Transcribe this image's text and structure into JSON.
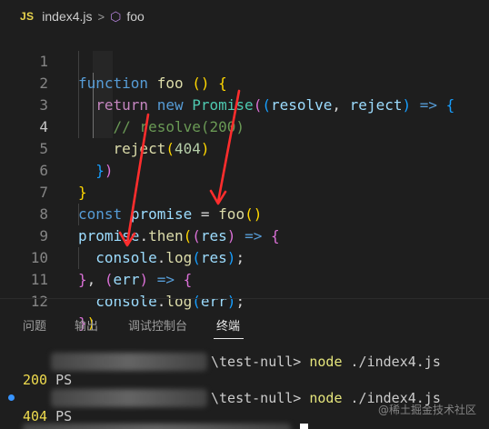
{
  "breadcrumb": {
    "file_badge": "JS",
    "file_name": "index4.js",
    "separator": ">",
    "symbol_icon": "cube-icon",
    "symbol_name": "foo"
  },
  "editor": {
    "active_line": 4,
    "line_numbers": [
      "1",
      "2",
      "3",
      "4",
      "5",
      "6",
      "7",
      "8",
      "9",
      "10",
      "11",
      "12"
    ],
    "lines": [
      "function foo () {",
      "  return new Promise((resolve, reject) => {",
      "    // resolve(200)",
      "    reject(404)",
      "  })",
      "}",
      "const promise = foo()",
      "promise.then((res) => {",
      "  console.log(res);",
      "}, (err) => {",
      "  console.log(err);",
      "})"
    ]
  },
  "annotation": {
    "arrow_color": "#ff2d2d"
  },
  "panel": {
    "tabs": [
      "问题",
      "输出",
      "调试控制台",
      "终端"
    ],
    "active_tab": "终端"
  },
  "terminal": {
    "runs": [
      {
        "prompt": "PS",
        "path": "\\test-null>",
        "command": "node",
        "args": "./index4.js",
        "output": "200"
      },
      {
        "prompt": "PS",
        "path": "\\test-null>",
        "command": "node",
        "args": "./index4.js",
        "output": "404"
      }
    ]
  },
  "watermark": "@稀土掘金技术社区",
  "colors": {
    "background": "#1e1e1e",
    "keyword": "#569cd6",
    "function": "#dcdcaa",
    "variable": "#9cdcfe",
    "class": "#4ec9b0",
    "number": "#b5cea8",
    "comment": "#6a9955",
    "bracket_gold": "#ffd700",
    "bracket_orchid": "#da70d6",
    "bracket_blue": "#179fff",
    "terminal_output": "#f0dc4e",
    "terminal_command": "#e5e57c"
  }
}
